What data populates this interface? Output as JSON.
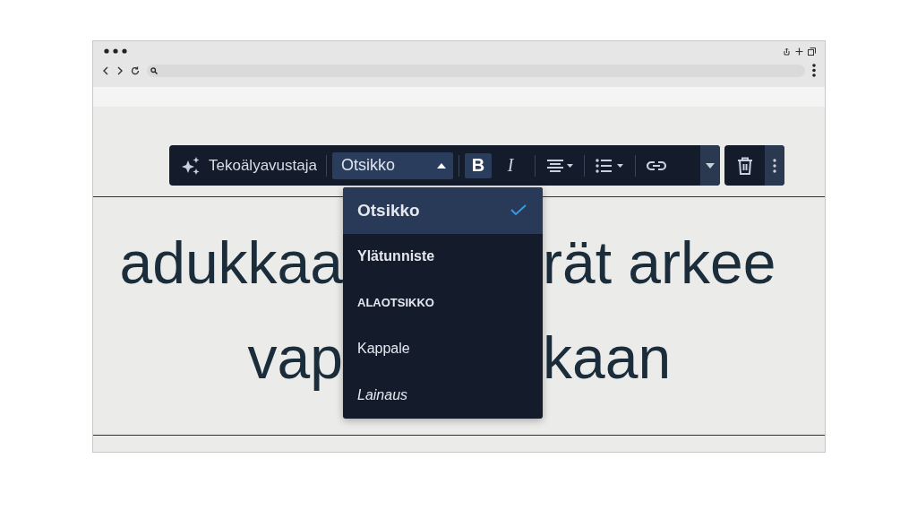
{
  "heading": {
    "lines": [
      {
        "left": "adukkaa",
        "right": "rät arkee"
      },
      {
        "left": "vap",
        "right": "kaan"
      }
    ]
  },
  "toolbar": {
    "assistant": "Tekoälyavustaja",
    "block_select": {
      "value": "Otsikko",
      "expanded": true
    },
    "bold": {
      "label": "B",
      "selected": true
    },
    "italic": {
      "label": "I",
      "selected": false
    }
  },
  "dropdown": {
    "items": [
      {
        "label": "Otsikko",
        "kind": "heading",
        "selected": true
      },
      {
        "label": "Ylätunniste",
        "kind": "header",
        "selected": false
      },
      {
        "label": "ALAOTSIKKO",
        "kind": "subheading",
        "selected": false
      },
      {
        "label": "Kappale",
        "kind": "paragraph",
        "selected": false
      },
      {
        "label": "Lainaus",
        "kind": "quote",
        "selected": false
      }
    ]
  }
}
